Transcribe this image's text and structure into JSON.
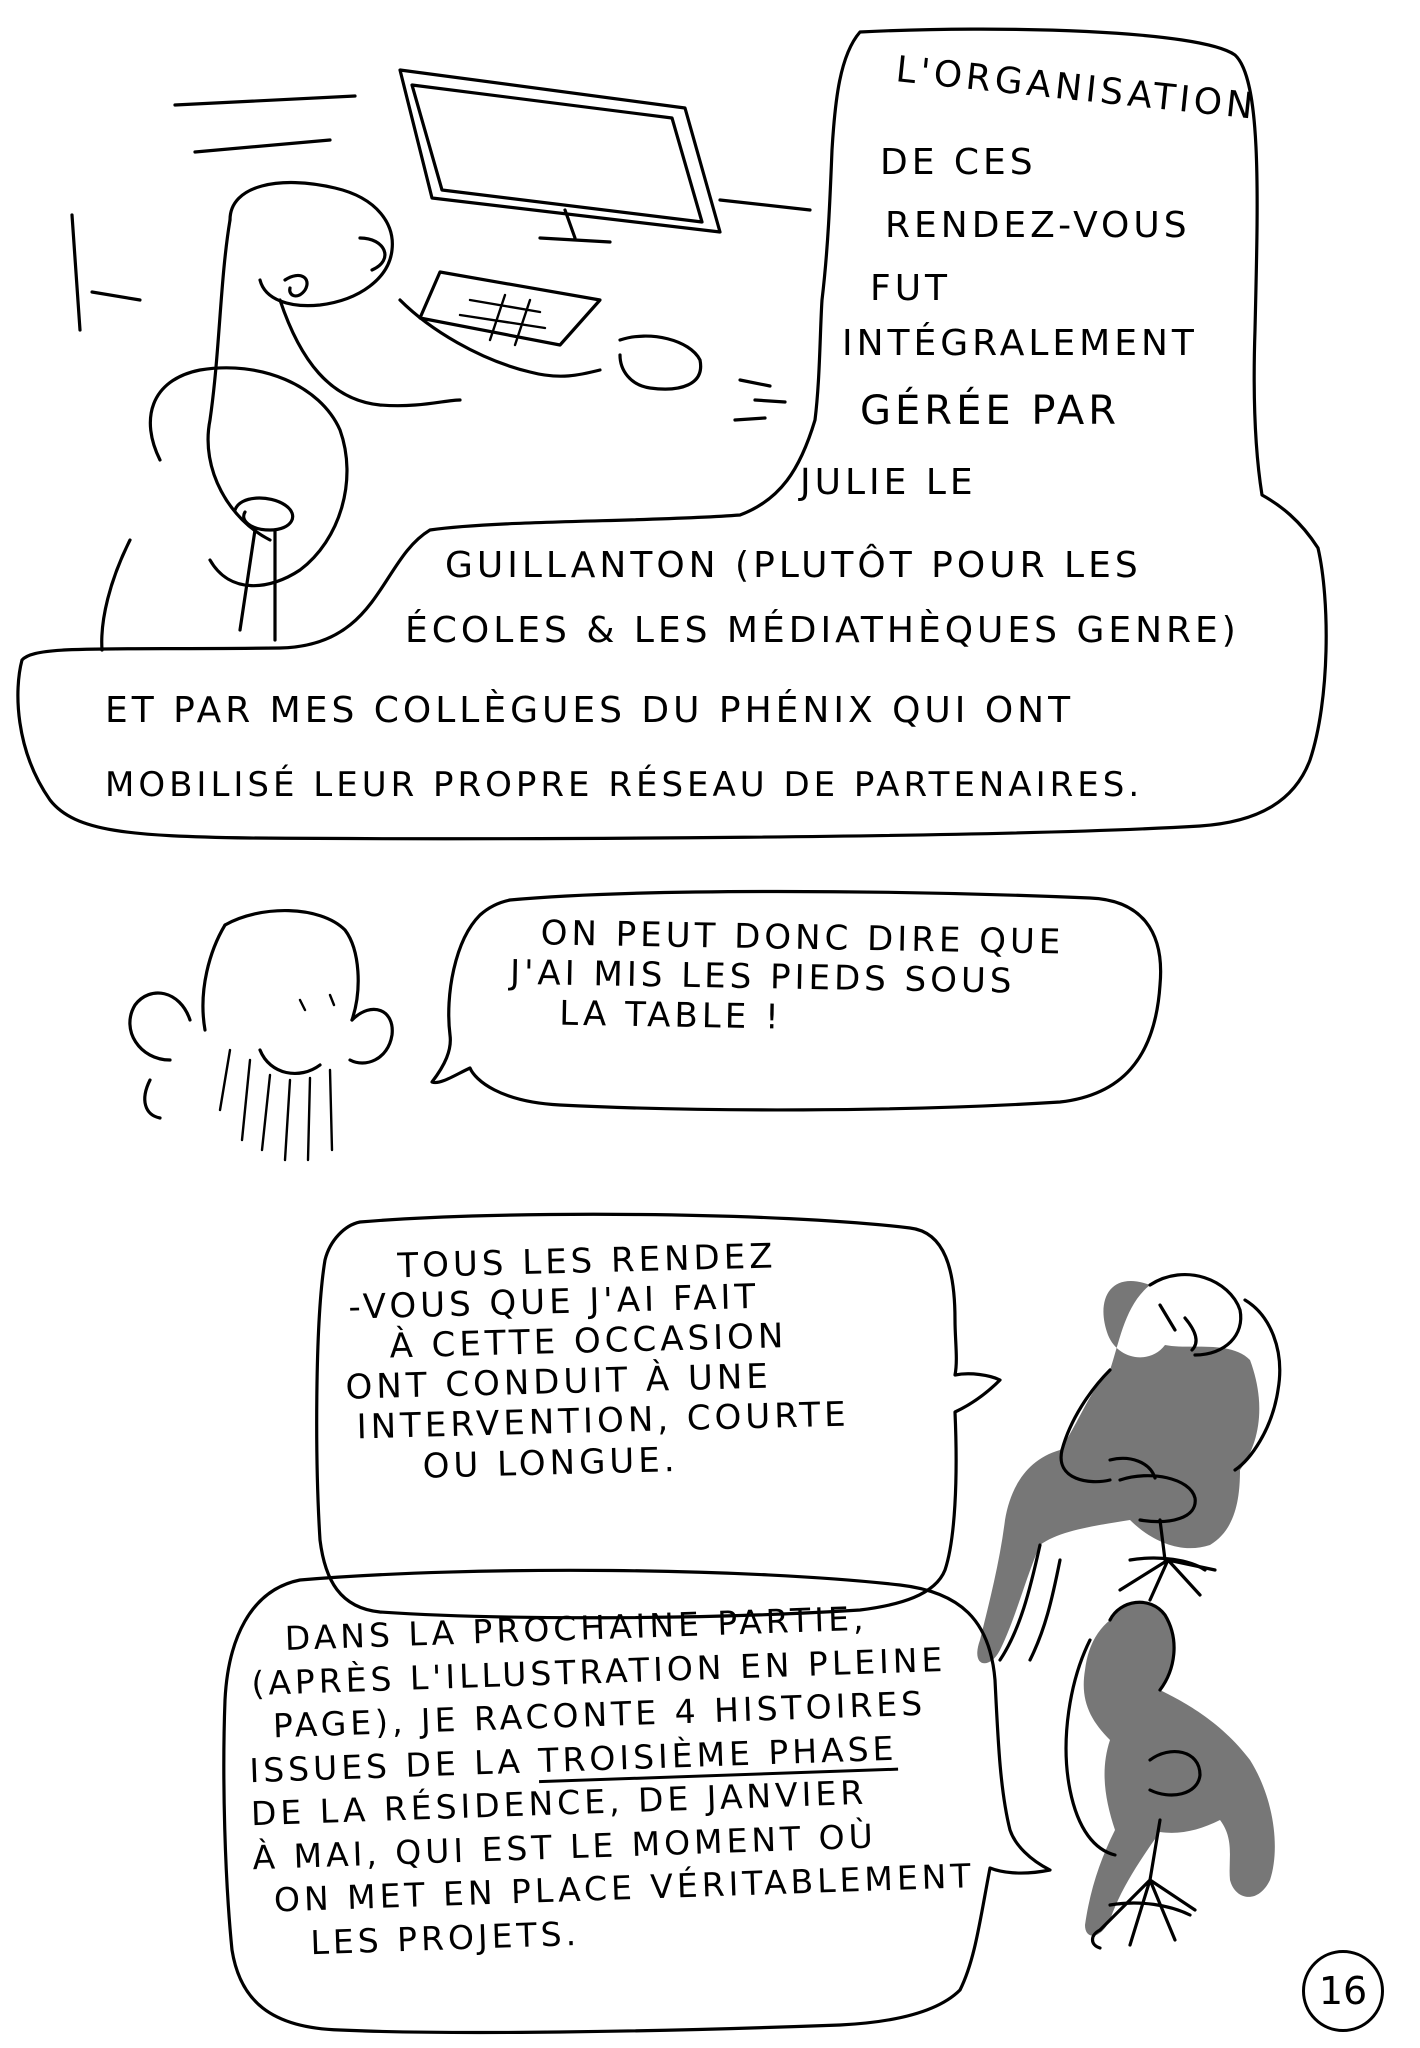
{
  "panel1": {
    "speech_lines": [
      "L'ORGANISATION",
      "DE CES",
      "RENDEZ-VOUS",
      "FUT",
      "INTÉGRALEMENT",
      "GÉRÉE PAR",
      "JULIE LE",
      "GUILLANTON (PLUTÔT POUR LES",
      "ÉCOLES & LES MÉDIATHÈQUES GENRE)",
      "ET PAR MES COLLÈGUES DU PHÉNIX QUI ONT",
      "MOBILISÉ LEUR PROPRE RÉSEAU DE PARTENAIRES."
    ]
  },
  "panel2": {
    "speech_lines": [
      "ON PEUT DONC DIRE QUE",
      "J'AI MIS LES PIEDS SOUS",
      "LA TABLE !"
    ]
  },
  "panel3": {
    "speech_lines": [
      "TOUS LES RENDEZ",
      "-VOUS QUE J'AI FAIT",
      "À CETTE OCCASION",
      "ONT CONDUIT À UNE",
      "INTERVENTION, COURTE",
      "OU LONGUE."
    ]
  },
  "panel4": {
    "speech_lines": [
      "DANS LA PROCHAINE PARTIE,",
      "(APRÈS L'ILLUSTRATION EN PLEINE",
      "PAGE), JE RACONTE 4 HISTOIRES"
    ],
    "line_issues_prefix": "ISSUES DE LA ",
    "line_issues_underlined": "TROISIÈME PHASE",
    "speech_lines_end": [
      "DE LA RÉSIDENCE, DE JANVIER",
      "À MAI, QUI EST LE MOMENT OÙ",
      "ON MET EN PLACE VÉRITABLEMENT",
      "LES PROJETS."
    ]
  },
  "page_number": "16",
  "colors": {
    "ink": "#000000",
    "shade": "#777777",
    "paper": "#ffffff"
  }
}
